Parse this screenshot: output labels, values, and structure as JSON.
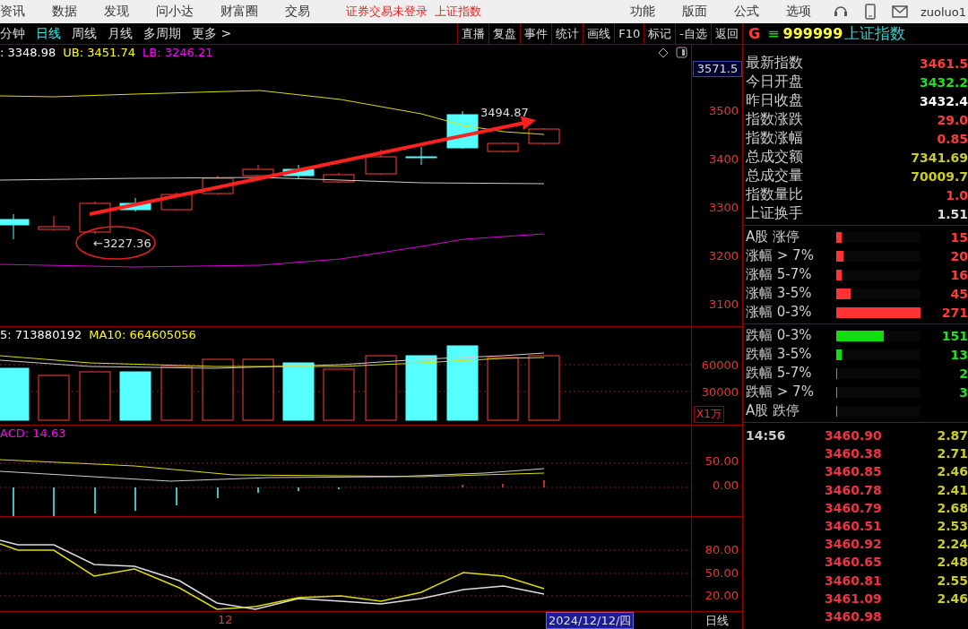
{
  "menu_bar": {
    "items": [
      "资讯",
      "数据",
      "发现",
      "问小达",
      "财富圈",
      "交易"
    ],
    "notice": "证券交易未登录",
    "notice_link": "上证指数",
    "right_items": [
      "功能",
      "版面",
      "公式",
      "选项"
    ],
    "user": "zuoluo1"
  },
  "toolbar": {
    "periods": [
      {
        "label": "分钟",
        "selected": false
      },
      {
        "label": "日线",
        "selected": true
      },
      {
        "label": "周线",
        "selected": false
      },
      {
        "label": "月线",
        "selected": false
      },
      {
        "label": "多周期",
        "selected": false
      },
      {
        "label": "更多 >",
        "selected": false
      }
    ],
    "buttons": [
      "直播",
      "复盘",
      "事件",
      "统计",
      "画线",
      "F10",
      "标记",
      "-自选",
      "返回"
    ]
  },
  "price_panel": {
    "legend": [
      {
        "text": ": 3348.98",
        "color": "#ffffff"
      },
      {
        "text": "UB: 3451.74",
        "color": "#ffff00"
      },
      {
        "text": "LB: 3246.21",
        "color": "#ff00ff"
      }
    ],
    "top_value": "3571.5",
    "axis_labels": [
      "3500",
      "3400",
      "3300",
      "3200",
      "3100"
    ],
    "high_label": "3494.87",
    "low_label": "←3227.36"
  },
  "volume_panel": {
    "legend": [
      {
        "text": "5: 713880192",
        "color": "#ffffff"
      },
      {
        "text": "MA10: 664605056",
        "color": "#ffff00"
      }
    ],
    "axis_labels": [
      "60000",
      "30000"
    ],
    "unit": "X1万"
  },
  "macd_panel": {
    "legend": [
      {
        "text": "ACD: 14.63",
        "color": "#ff00ff"
      }
    ],
    "axis_labels": [
      "50.00",
      "0.00"
    ]
  },
  "kdj_panel": {
    "axis_labels": [
      "80.00",
      "50.00",
      "20.00"
    ]
  },
  "date_bar": {
    "month": "12",
    "cursor_date": "2024/12/12/四",
    "period": "日线"
  },
  "quote": {
    "prefix": "G",
    "menu_glyph": "≡",
    "code": "999999",
    "name": "上证指数",
    "stats": [
      {
        "label": "最新指数",
        "value": "3461.5",
        "color": "#ff3b3b"
      },
      {
        "label": "今日开盘",
        "value": "3432.2",
        "color": "#22dd22"
      },
      {
        "label": "昨日收盘",
        "value": "3432.4",
        "color": "#ffffff"
      },
      {
        "label": "指数涨跌",
        "value": "29.0",
        "color": "#ff3b3b"
      },
      {
        "label": "指数涨幅",
        "value": "0.85",
        "color": "#ff3b3b"
      },
      {
        "label": "总成交额",
        "value": "7341.69",
        "color": "#cccc22"
      },
      {
        "label": "总成交量",
        "value": "70009.7",
        "color": "#cccc22"
      },
      {
        "label": "指数量比",
        "value": "1.0",
        "color": "#ff3b3b"
      },
      {
        "label": "上证换手",
        "value": "1.51",
        "color": "#dddddd"
      }
    ],
    "breadth_up": [
      {
        "label": "A股 涨停",
        "level": 0.06,
        "count": "15"
      },
      {
        "label": "涨幅 > 7%",
        "level": 0.08,
        "count": "20"
      },
      {
        "label": "涨幅 5-7%",
        "level": 0.06,
        "count": "16"
      },
      {
        "label": "涨幅 3-5%",
        "level": 0.17,
        "count": "45"
      },
      {
        "label": "涨幅 0-3%",
        "level": 1.0,
        "count": "271"
      }
    ],
    "breadth_down": [
      {
        "label": "跌幅 0-3%",
        "level": 0.56,
        "count": "151"
      },
      {
        "label": "跌幅 3-5%",
        "level": 0.06,
        "count": "13"
      },
      {
        "label": "跌幅 5-7%",
        "level": 0.01,
        "count": "2"
      },
      {
        "label": "跌幅 > 7%",
        "level": 0.01,
        "count": "3"
      },
      {
        "label": "A股 跌停",
        "level": 0.01
      }
    ],
    "ticks": [
      {
        "time": "14:56",
        "price": "3460.90",
        "amount": "2.87"
      },
      {
        "price": "3460.38",
        "amount": "2.71"
      },
      {
        "price": "3460.85",
        "amount": "2.46"
      },
      {
        "price": "3460.78",
        "amount": "2.41"
      },
      {
        "price": "3460.79",
        "amount": "2.68"
      },
      {
        "price": "3460.51",
        "amount": "2.53"
      },
      {
        "price": "3460.92",
        "amount": "2.24"
      },
      {
        "price": "3460.65",
        "amount": "2.48"
      },
      {
        "price": "3460.81",
        "amount": "2.55"
      },
      {
        "price": "3461.09",
        "amount": "2.46"
      },
      {
        "price": "3460.98"
      }
    ]
  }
}
